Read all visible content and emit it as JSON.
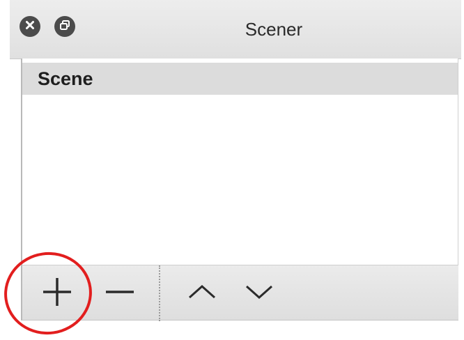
{
  "window": {
    "title": "Scener",
    "close_icon": "close-icon",
    "float_icon": "undock-icon"
  },
  "scene_list": {
    "items": [
      {
        "label": "Scene",
        "selected": true
      }
    ]
  },
  "toolbar": {
    "buttons": [
      {
        "icon": "plus-icon",
        "action": "add"
      },
      {
        "icon": "minus-icon",
        "action": "remove"
      },
      {
        "icon": "chevron-up-icon",
        "action": "move-up"
      },
      {
        "icon": "chevron-down-icon",
        "action": "move-down"
      }
    ]
  },
  "annotation": {
    "color": "#e21e1e",
    "target": "add-scene-button"
  },
  "colors": {
    "titlebar": "#e6e6e6",
    "selected_row": "#dcdcdc",
    "toolbar": "#e4e4e4",
    "icon": "#2b2b2b"
  }
}
